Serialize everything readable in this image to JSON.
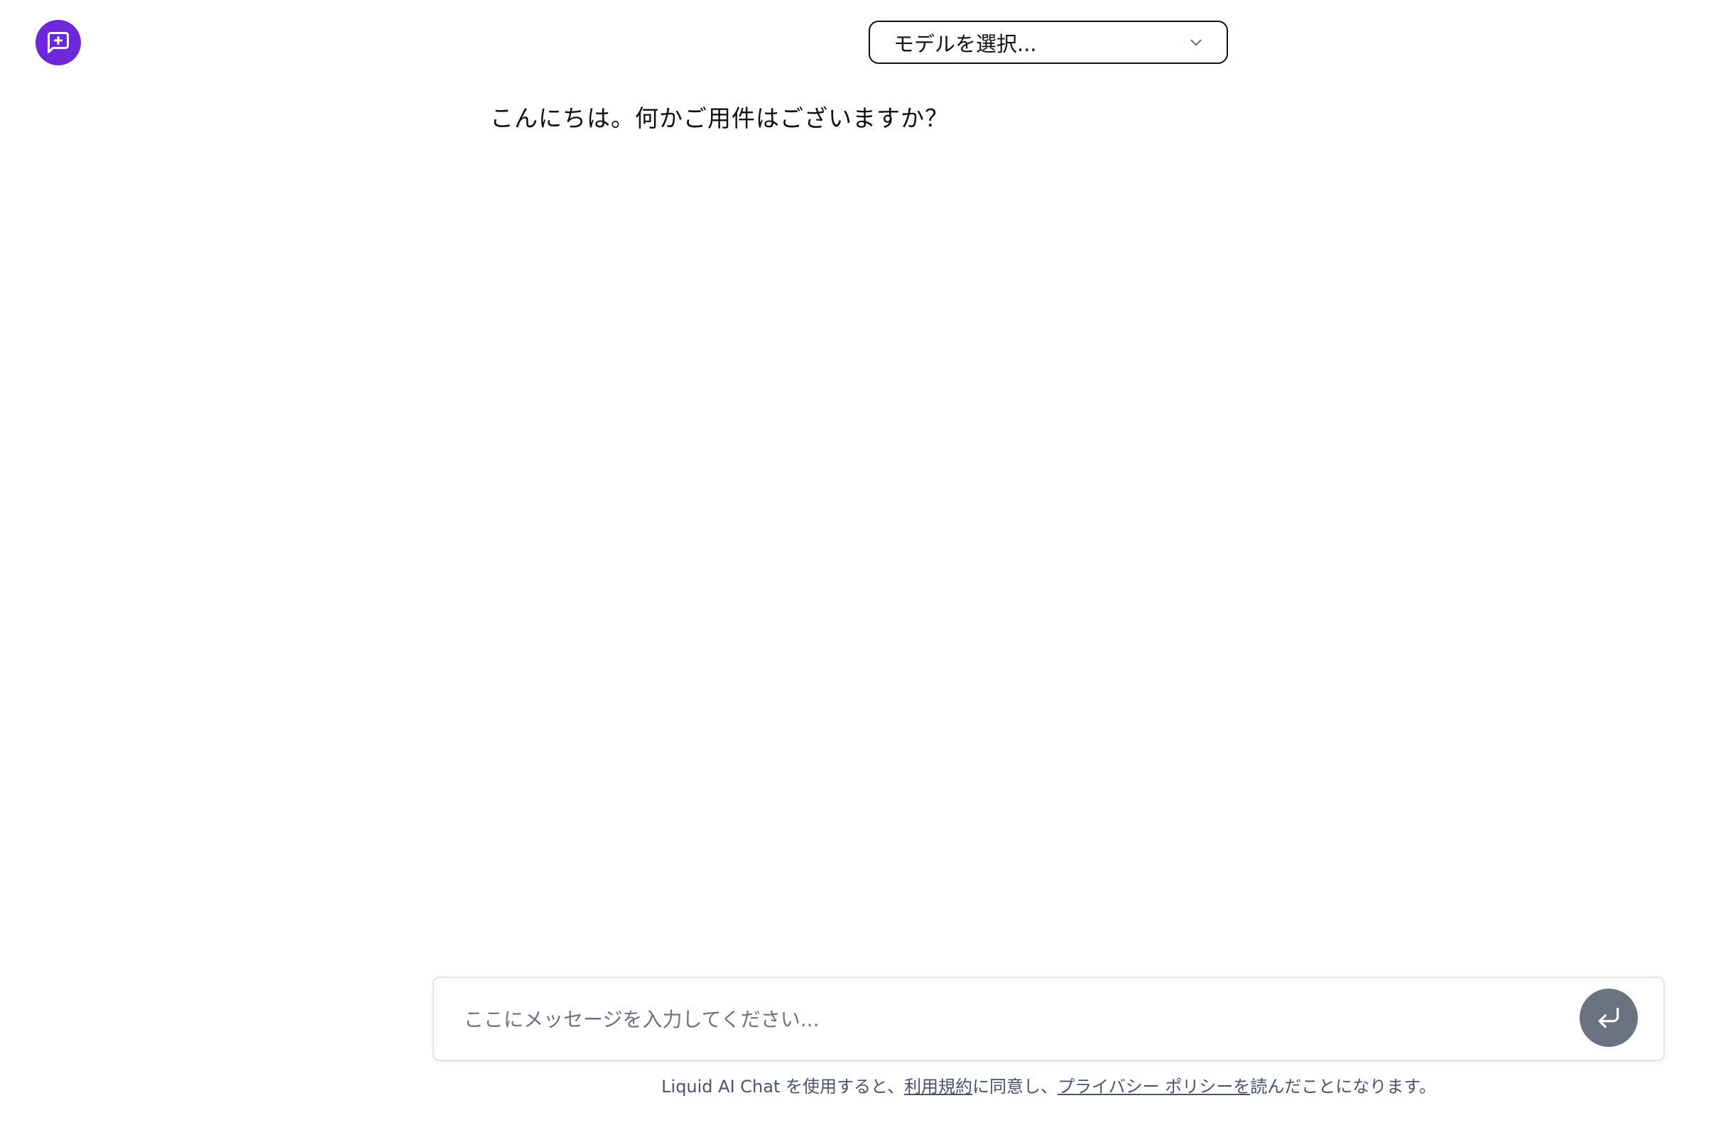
{
  "header": {
    "new_chat_icon": "message-square-plus-icon",
    "model_select": {
      "label": "モデルを選択...",
      "icon": "chevron-down-icon"
    }
  },
  "conversation": {
    "greeting": "こんにちは。何かご用件はございますか？"
  },
  "composer": {
    "placeholder": "ここにメッセージを入力してください...",
    "value": "",
    "send_icon": "corner-down-left-icon"
  },
  "footer": {
    "prefix": "Liquid AI Chat を使用すると、",
    "terms_link": "利用規約",
    "middle": "に同意し、",
    "privacy_link": "プライバシー ポリシーを",
    "suffix": "読んだことになります。"
  },
  "colors": {
    "accent": "#6d28d9",
    "send_button": "#6b7280",
    "muted_text": "#4b5563"
  }
}
